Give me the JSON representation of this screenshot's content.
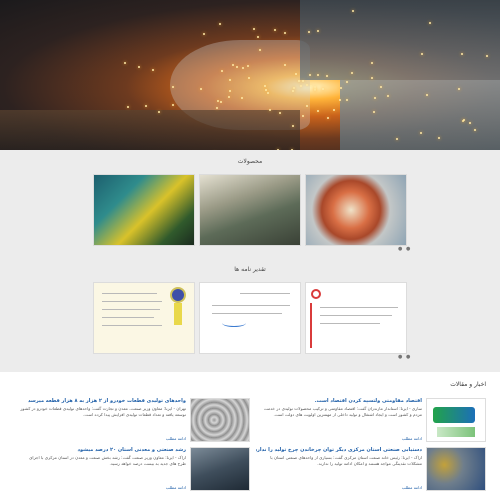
{
  "hero": {
    "image": "industrial-grinding-sparks"
  },
  "products": {
    "title": "محصولات",
    "items": [
      {
        "name": "industrial-power-unit"
      },
      {
        "name": "warehouse-beams"
      },
      {
        "name": "pipe-cross-section"
      }
    ]
  },
  "certificates": {
    "title": "تقدیر نامه ها",
    "items": [
      {
        "name": "certificate-with-seal"
      },
      {
        "name": "letter-signed"
      },
      {
        "name": "letter-with-logo"
      }
    ]
  },
  "news": {
    "title": "اخبار و مقالات",
    "items": [
      {
        "title": "اقتصاد مقاومتی ولتسپه کردن اقتصاد است.",
        "text": "ساری - ایرنا: استاندار مازندران گفت: اقتصاد مقاومتی و ترکیب محصولات تولیدی در خدمت مردم و کشور است و ایجاد اشتغال و تولید داخلی از مهمترین اولویت های دولت است.",
        "more": "ادامه مطلب"
      },
      {
        "title": "واحدهای تولیدی قطعات خودرو از ۲ هزار به ۸ هزار قطعه میرسد",
        "text": "تهران - ایرنا: معاون وزیر صنعت، معدن و تجارت گفت: واحدهای تولیدی قطعات خودرو در کشور توسعه یافته و تعداد قطعات تولیدی افزایش پیدا کرده است.",
        "more": "ادامه مطلب"
      },
      {
        "title": "دستیابی صنعتی استان مرکزی دیگر توان چرخاندن چرخ تولید را ندارد",
        "text": "اراک - ایرنا: رئیس خانه صنعت استان مرکزی گفت: بسیاری از واحدهای صنعتی استان با مشکلات نقدینگی مواجه هستند و امکان ادامه تولید را ندارند.",
        "more": "ادامه مطلب"
      },
      {
        "title": "رشد صنعتی و معدنی استان ۲۰ درصد میشود",
        "text": "اراک - ایرنا: معاون وزیر صنعت گفت: رشد بخش صنعت و معدن در استان مرکزی با اجرای طرح های جدید به بیست درصد خواهد رسید.",
        "more": "ادامه مطلب"
      }
    ]
  }
}
